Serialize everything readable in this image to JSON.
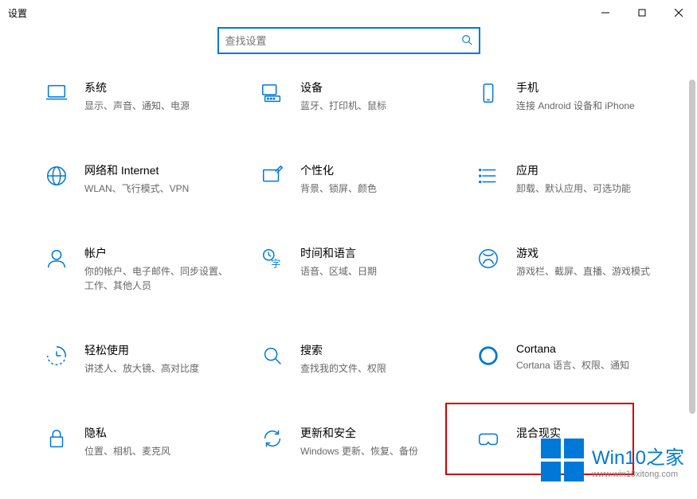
{
  "window": {
    "title": "设置"
  },
  "search": {
    "placeholder": "查找设置"
  },
  "tiles": [
    {
      "id": "system",
      "title": "系统",
      "sub": "显示、声音、通知、电源"
    },
    {
      "id": "devices",
      "title": "设备",
      "sub": "蓝牙、打印机、鼠标"
    },
    {
      "id": "phone",
      "title": "手机",
      "sub": "连接 Android 设备和 iPhone"
    },
    {
      "id": "network",
      "title": "网络和 Internet",
      "sub": "WLAN、飞行模式、VPN"
    },
    {
      "id": "personalization",
      "title": "个性化",
      "sub": "背景、锁屏、颜色"
    },
    {
      "id": "apps",
      "title": "应用",
      "sub": "卸载、默认应用、可选功能"
    },
    {
      "id": "accounts",
      "title": "帐户",
      "sub": "你的帐户、电子邮件、同步设置、工作、其他人员"
    },
    {
      "id": "time",
      "title": "时间和语言",
      "sub": "语音、区域、日期"
    },
    {
      "id": "gaming",
      "title": "游戏",
      "sub": "游戏栏、截屏、直播、游戏模式"
    },
    {
      "id": "ease",
      "title": "轻松使用",
      "sub": "讲述人、放大镜、高对比度"
    },
    {
      "id": "search",
      "title": "搜索",
      "sub": "查找我的文件、权限"
    },
    {
      "id": "cortana",
      "title": "Cortana",
      "sub": "Cortana 语言、权限、通知"
    },
    {
      "id": "privacy",
      "title": "隐私",
      "sub": "位置、相机、麦克风"
    },
    {
      "id": "update",
      "title": "更新和安全",
      "sub": "Windows 更新、恢复、备份"
    },
    {
      "id": "mixedreality",
      "title": "混合现实",
      "sub": ""
    }
  ],
  "watermark": {
    "title": "Win10之家",
    "url": "www.win10xitong.com"
  }
}
